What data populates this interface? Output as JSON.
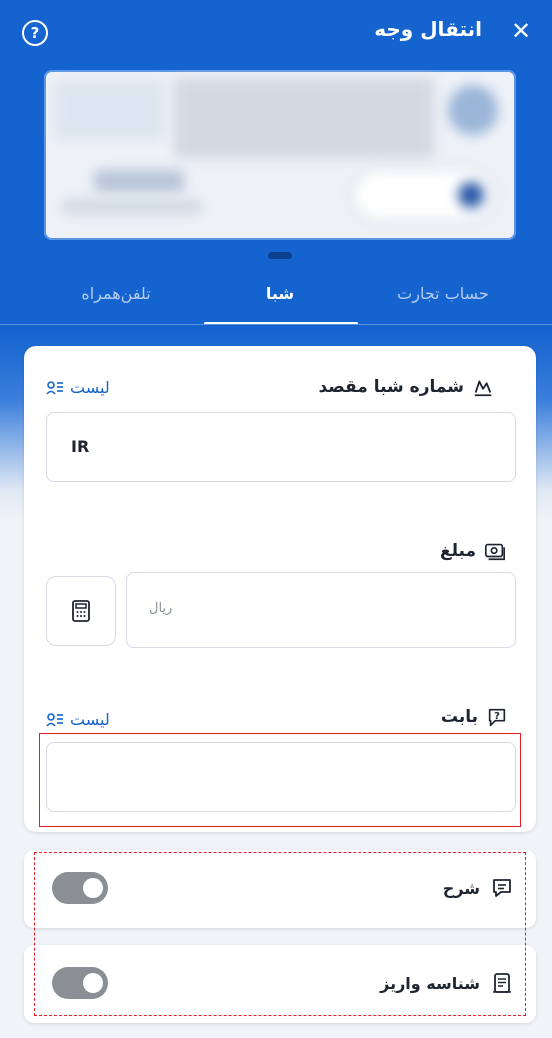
{
  "header": {
    "title": "انتقال وجه",
    "close_icon": "close-icon",
    "help_icon": "help-circle-icon"
  },
  "tabs": [
    {
      "label": "حساب تجارت",
      "active": false
    },
    {
      "label": "شبا",
      "active": true
    },
    {
      "label": "تلفن‌همراه",
      "active": false
    }
  ],
  "form": {
    "iban": {
      "label": "شماره شبا مقصد",
      "list_label": "لیست",
      "value": "IR"
    },
    "amount": {
      "label": "مبلغ",
      "placeholder": "ریال"
    },
    "reason": {
      "label": "بابت",
      "list_label": "لیست",
      "value": ""
    }
  },
  "options": [
    {
      "label": "شرح",
      "enabled": false
    },
    {
      "label": "شناسه واریز",
      "enabled": false
    }
  ],
  "colors": {
    "primary": "#1463cf",
    "annotation": "#e21f26",
    "toggle_off": "#8a8f95"
  }
}
